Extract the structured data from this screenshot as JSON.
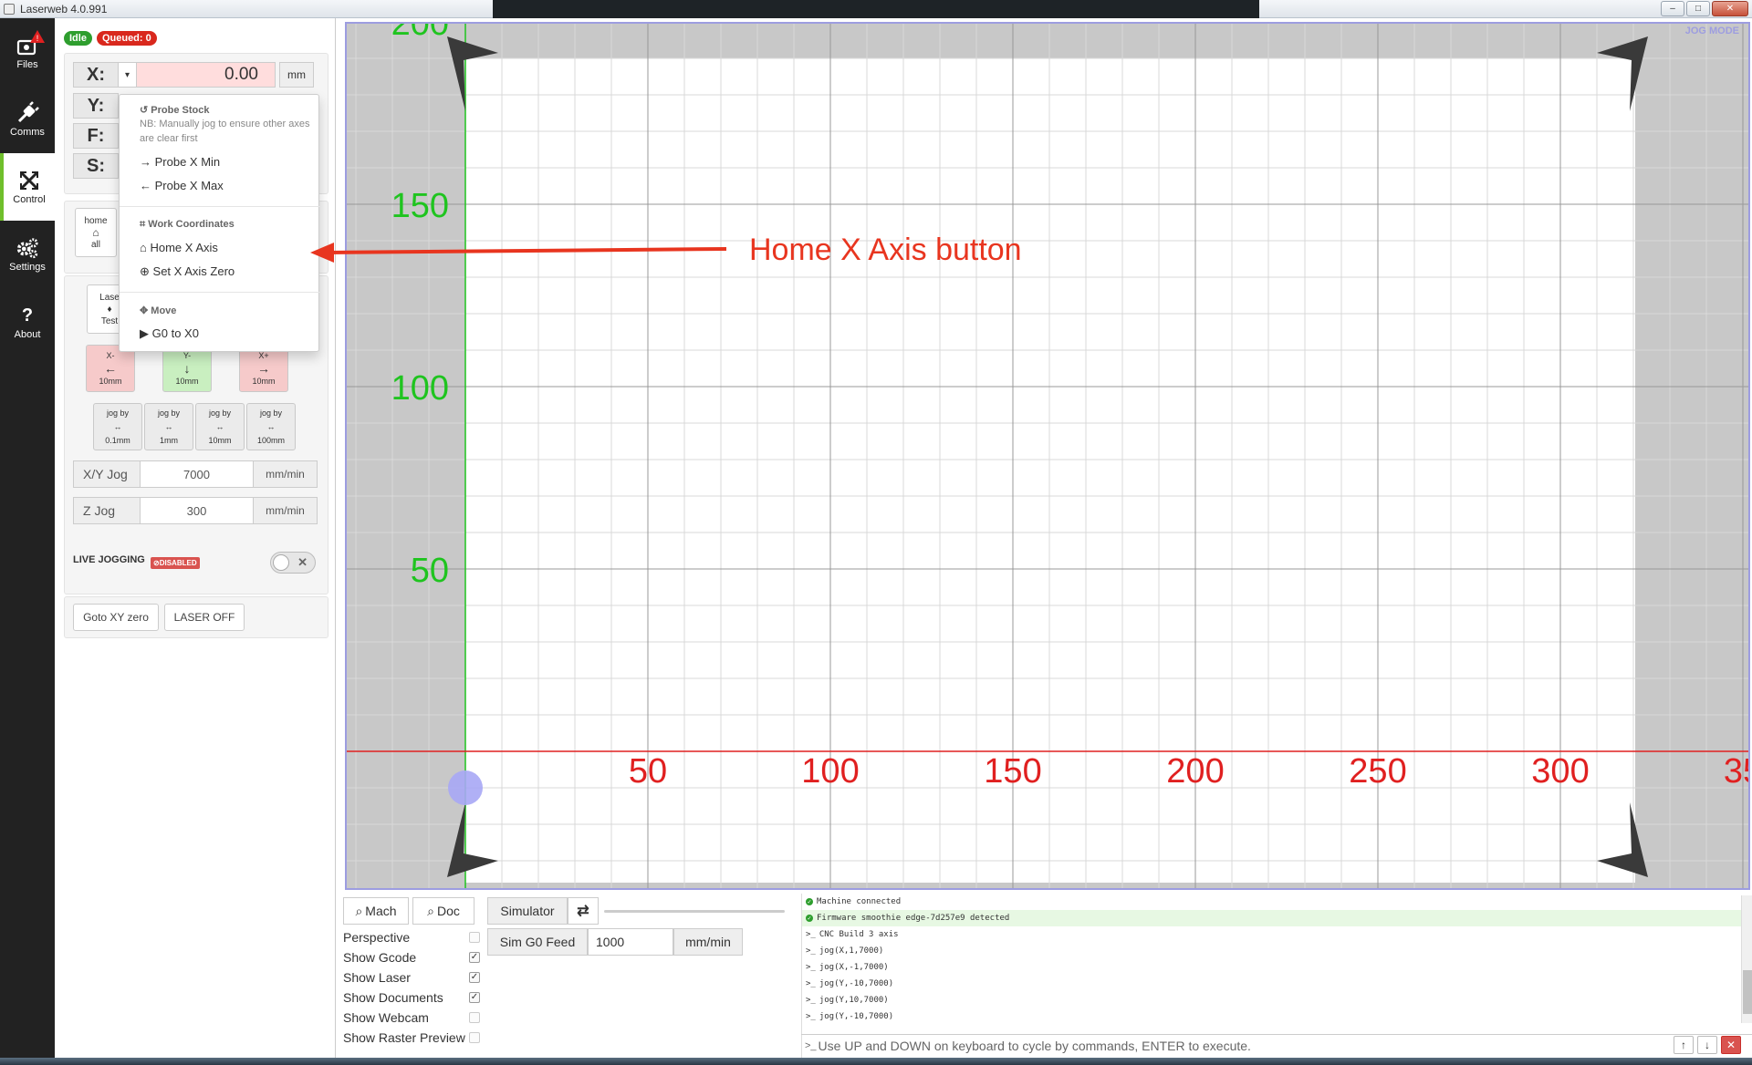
{
  "window": {
    "title": "Laserweb 4.0.991",
    "jog_mode": "JOG MODE"
  },
  "nav": [
    {
      "label": "Files",
      "icon": "folder-alert-icon"
    },
    {
      "label": "Comms",
      "icon": "plug-icon"
    },
    {
      "label": "Control",
      "icon": "arrows-icon"
    },
    {
      "label": "Settings",
      "icon": "cogs-icon"
    },
    {
      "label": "About",
      "icon": "question-icon"
    }
  ],
  "status": {
    "idle": "Idle",
    "queued": "Queued: 0"
  },
  "axes": [
    {
      "key": "X:",
      "value": "0.00",
      "unit": "mm"
    },
    {
      "key": "Y:"
    },
    {
      "key": "F:"
    },
    {
      "key": "S:"
    }
  ],
  "home_all": {
    "line1": "home",
    "line2": "all"
  },
  "laser_test": {
    "line1": "Lase",
    "line2": "Test"
  },
  "jog": {
    "xminus": {
      "label": "X-",
      "step": "10mm"
    },
    "yminus": {
      "label": "Y-",
      "step": "10mm"
    },
    "xplus": {
      "label": "X+",
      "step": "10mm"
    },
    "steps": [
      {
        "label": "jog by",
        "value": "0.1mm"
      },
      {
        "label": "jog by",
        "value": "1mm"
      },
      {
        "label": "jog by",
        "value": "10mm"
      },
      {
        "label": "jog by",
        "value": "100mm"
      }
    ],
    "xy_jog": {
      "label": "X/Y Jog",
      "value": "7000",
      "unit": "mm/min"
    },
    "z_jog": {
      "label": "Z Jog",
      "value": "300",
      "unit": "mm/min"
    },
    "live_label": "LIVE JOGGING",
    "live_badge": "⊘DISABLED",
    "goto_xy": "Goto XY zero",
    "laser_off": "LASER OFF"
  },
  "dropdown": {
    "probe_header": "Probe Stock",
    "probe_note": "NB: Manually jog to ensure other axes are clear first",
    "probe_min": "Probe X Min",
    "probe_max": "Probe X Max",
    "work_header": "Work Coordinates",
    "home_axis": "Home X Axis",
    "set_zero": "Set X Axis Zero",
    "move_header": "Move",
    "g0": "G0 to X0"
  },
  "annotation": "Home X Axis button",
  "canvas": {
    "y_labels": [
      "200",
      "150",
      "100",
      "50"
    ],
    "x_labels": [
      "50",
      "100",
      "150",
      "200",
      "250",
      "300",
      "35"
    ],
    "y_color": "#1fc41f",
    "x_color": "#e02020"
  },
  "bottom": {
    "mach": "Mach",
    "doc": "Doc",
    "simulator": "Simulator",
    "sim_feed_label": "Sim G0 Feed",
    "sim_feed_value": "1000",
    "sim_feed_unit": "mm/min",
    "options": [
      {
        "label": "Perspective",
        "checked": false
      },
      {
        "label": "Show Gcode",
        "checked": true
      },
      {
        "label": "Show Laser",
        "checked": true
      },
      {
        "label": "Show Documents",
        "checked": true
      },
      {
        "label": "Show Webcam",
        "checked": false
      },
      {
        "label": "Show Raster Preview",
        "checked": false
      }
    ]
  },
  "console": {
    "lines": [
      {
        "kind": "ok",
        "text": "Machine connected"
      },
      {
        "kind": "ok",
        "text": "Firmware smoothie edge-7d257e9 detected"
      },
      {
        "kind": "cmd",
        "text": "CNC Build 3 axis"
      },
      {
        "kind": "cmd",
        "text": "jog(X,1,7000)"
      },
      {
        "kind": "cmd",
        "text": "jog(X,-1,7000)"
      },
      {
        "kind": "cmd",
        "text": "jog(Y,-10,7000)"
      },
      {
        "kind": "cmd",
        "text": "jog(Y,10,7000)"
      },
      {
        "kind": "cmd",
        "text": "jog(Y,-10,7000)"
      }
    ],
    "hint": "Use UP and DOWN on keyboard to cycle by commands, ENTER to execute."
  }
}
